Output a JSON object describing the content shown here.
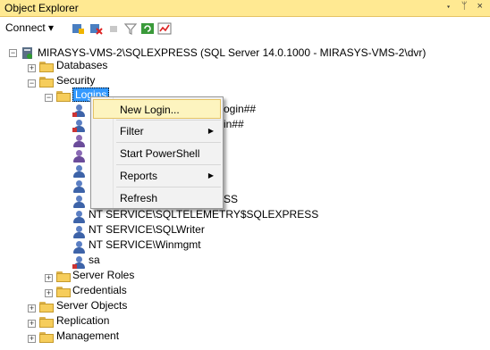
{
  "window": {
    "title": "Object Explorer",
    "title_icons": "▾ ᛘ ×"
  },
  "toolbar": {
    "connect_label": "Connect ▾"
  },
  "tree": {
    "server": "MIRASYS-VMS-2\\SQLEXPRESS (SQL Server 14.0.1000 - MIRASYS-VMS-2\\dvr)",
    "databases": "Databases",
    "security": "Security",
    "logins": "Logins",
    "partial_login_1": "ogin##",
    "partial_login_2": "in##",
    "partial_login_3": "SS",
    "login_items": [
      "NT SERVICE\\SQLTELEMETRY$SQLEXPRESS",
      "NT SERVICE\\SQLWriter",
      "NT SERVICE\\Winmgmt",
      "sa"
    ],
    "server_roles": "Server Roles",
    "credentials": "Credentials",
    "server_objects": "Server Objects",
    "replication": "Replication",
    "management": "Management",
    "expander_plus": "+",
    "expander_minus": "−"
  },
  "context_menu": {
    "items": [
      {
        "label": "New Login...",
        "submenu": false
      },
      {
        "label": "Filter",
        "submenu": true
      },
      {
        "label": "Start PowerShell",
        "submenu": false
      },
      {
        "label": "Reports",
        "submenu": true
      },
      {
        "label": "Refresh",
        "submenu": false
      }
    ],
    "arrow": "▶"
  },
  "colors": {
    "titlebar": "#ffe992",
    "highlight": "#fdf4bf",
    "selection": "#3399ff"
  }
}
